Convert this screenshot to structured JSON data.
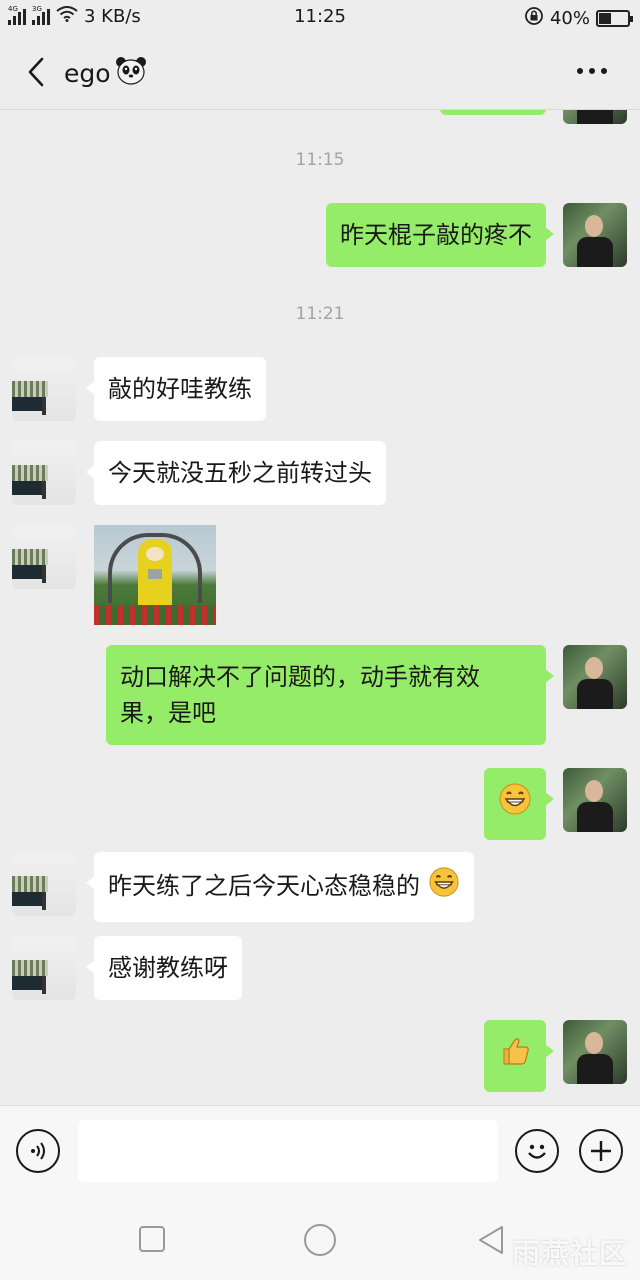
{
  "status_bar": {
    "left_net1": "4G",
    "left_net2": "3G",
    "speed": "3 KB/s",
    "time": "11:25",
    "battery_text": "40%",
    "battery_level": 0.4
  },
  "header": {
    "contact_name": "ego",
    "back_icon": "chevron-left-icon",
    "more_icon": "more-dots-icon"
  },
  "chat": {
    "timestamps": [
      "11:15",
      "11:21"
    ],
    "messages": [
      {
        "from": "me",
        "text": "昨天棍子敲的疼不"
      },
      {
        "from": "them",
        "text": "敲的好哇教练"
      },
      {
        "from": "them",
        "text": "今天就没五秒之前转过头"
      },
      {
        "from": "them",
        "type": "image",
        "description_icon": "teletubby-image"
      },
      {
        "from": "me",
        "text_line1": "动口解决不了问题的，动手就有效",
        "text_line2": "果，是吧"
      },
      {
        "from": "me",
        "type": "emoji",
        "emoji": "grinning-emoji"
      },
      {
        "from": "them",
        "text": "昨天练了之后今天心态稳稳的"
      },
      {
        "from": "them",
        "text": "感谢教练呀"
      },
      {
        "from": "me",
        "type": "emoji",
        "emoji": "thumbs-up-emoji"
      }
    ]
  },
  "input_bar": {
    "voice_icon": "voice-icon",
    "emoji_icon": "smiley-icon",
    "plus_icon": "plus-icon",
    "value": ""
  },
  "nav_bar": {
    "watermark": "雨燕社区"
  },
  "colors": {
    "me_bubble": "#95ec69",
    "them_bubble": "#ffffff",
    "background": "#ededed"
  }
}
